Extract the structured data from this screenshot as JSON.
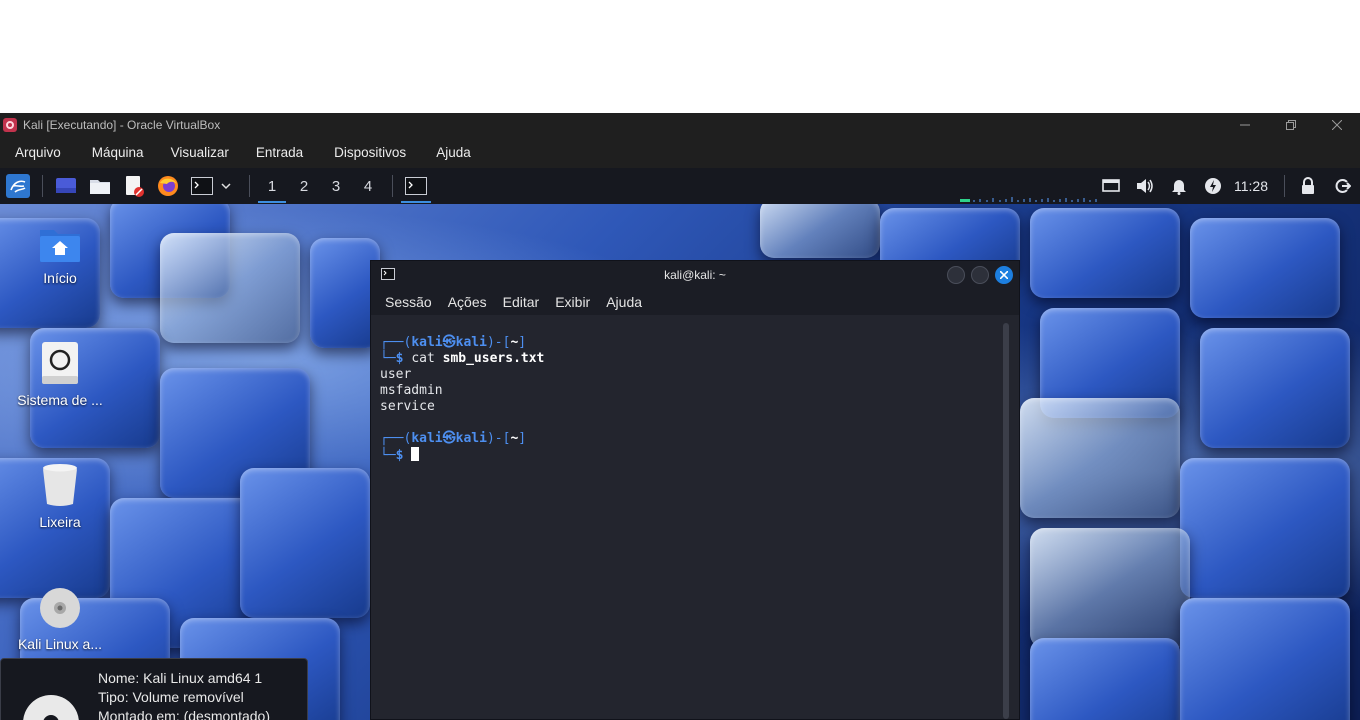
{
  "host_window": {
    "title": "Kali [Executando] - Oracle VirtualBox",
    "controls": [
      "minimize",
      "restore",
      "close"
    ]
  },
  "host_menu": [
    "Arquivo",
    "Máquina",
    "Visualizar",
    "Entrada",
    "Dispositivos",
    "Ajuda"
  ],
  "panel": {
    "launchers": [
      "kali-menu-icon",
      "desktop-icon",
      "file-manager-icon",
      "text-editor-icon",
      "firefox-icon",
      "terminal-icon",
      "chevron-down-icon"
    ],
    "workspaces": [
      "1",
      "2",
      "3",
      "4"
    ],
    "active_workspace": "1",
    "clock": "11:28",
    "tray": [
      "display-icon",
      "volume-icon",
      "bell-icon",
      "power-manager-icon",
      "lock-icon",
      "logout-icon"
    ]
  },
  "desktop": {
    "icons": [
      {
        "label": "Início"
      },
      {
        "label": "Sistema de ..."
      },
      {
        "label": "Lixeira"
      },
      {
        "label": "Kali Linux a..."
      }
    ],
    "tooltip": {
      "lines": [
        "Nome: Kali Linux amd64 1",
        "Tipo: Volume removível",
        "Montado em: (desmontado)"
      ]
    }
  },
  "terminal": {
    "title": "kali@kali: ~",
    "menu": [
      "Sessão",
      "Ações",
      "Editar",
      "Exibir",
      "Ajuda"
    ],
    "prompt_user": "kali",
    "prompt_host": "kali",
    "prompt_dir": "~",
    "command": "cat",
    "command_arg": "smb_users.txt",
    "output": [
      "user",
      "msfadmin",
      "service"
    ]
  },
  "colors": {
    "accent": "#3d8fe0",
    "prompt": "#4d8ff0",
    "terminal_bg": "#23252e",
    "panel_bg": "#16181f"
  }
}
